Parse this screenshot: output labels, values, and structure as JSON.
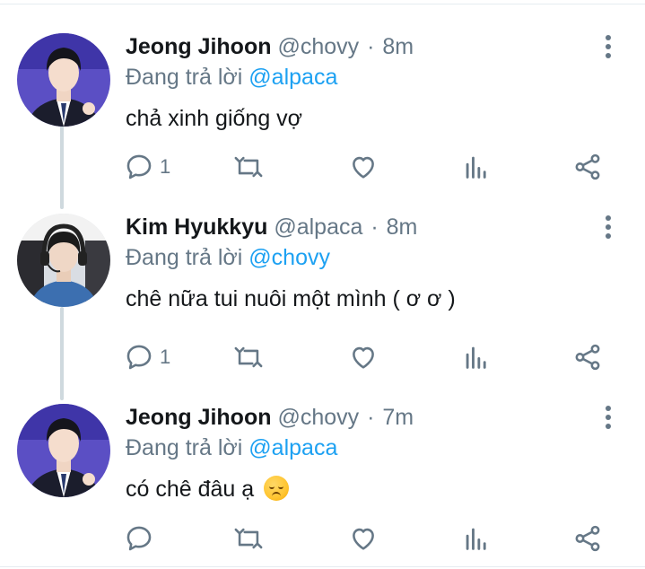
{
  "replying_prefix": "Đang trả lời",
  "tweets": [
    {
      "name": "Jeong Jihoon",
      "handle": "@chovy",
      "separator": "·",
      "time": "8m",
      "reply_to": "@alpaca",
      "text": "chả xinh giống vợ",
      "reply_count": "1",
      "emoji": ""
    },
    {
      "name": "Kim Hyukkyu",
      "handle": "@alpaca",
      "separator": "·",
      "time": "8m",
      "reply_to": "@chovy",
      "text": "chê nữa tui nuôi một mình ( ơ ơ )",
      "reply_count": "1",
      "emoji": ""
    },
    {
      "name": "Jeong Jihoon",
      "handle": "@chovy",
      "separator": "·",
      "time": "7m",
      "reply_to": "@alpaca",
      "text": "có chê đâu ạ",
      "reply_count": "",
      "emoji": "disappointed-face"
    }
  ],
  "colors": {
    "link": "#1da1f2",
    "secondary_text": "#657786",
    "primary_text": "#14171a",
    "thread_line": "#cfd9de"
  }
}
